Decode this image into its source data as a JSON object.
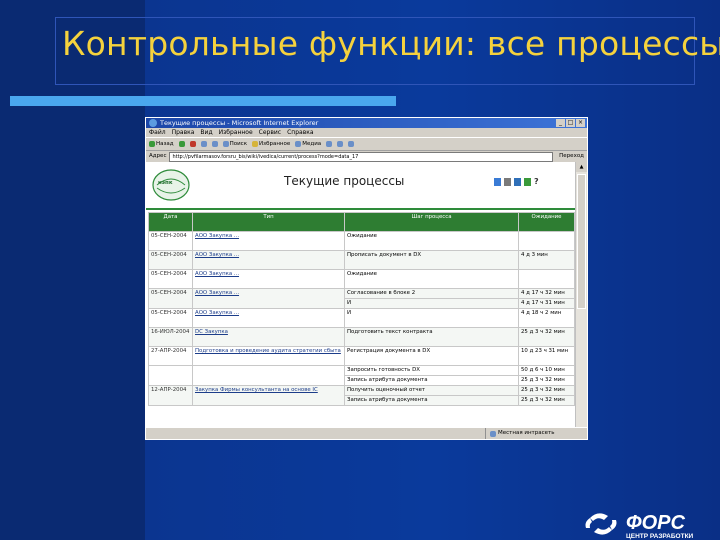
{
  "slide": {
    "title": "Контрольные функции: все процессы"
  },
  "colors": {
    "slide_bg": "#0a3a9c",
    "title_color": "#f5d23d",
    "underline": "#4aa7ee",
    "table_header": "#2e7d32"
  },
  "browser": {
    "title": "Текущие процессы - Microsoft Internet Explorer",
    "menu": [
      "Файл",
      "Правка",
      "Вид",
      "Избранное",
      "Сервис",
      "Справка"
    ],
    "toolbar": {
      "back_label": "Назад",
      "search_label": "Поиск",
      "favorites_label": "Избранное",
      "media_label": "Медиа"
    },
    "address_label": "Адрес",
    "address_value": "http://pvfilarmasov.forsru_bis/wiki/ivedica/current/process?mode=data_17",
    "go_label": "Переход",
    "status_left": "",
    "status_right": "Местная интрасеть"
  },
  "app": {
    "logo_text": "нэпк",
    "heading": "Текущие процессы",
    "help_label": "?",
    "icons": [
      "home-icon",
      "tools-icon",
      "people-icon",
      "document-icon"
    ]
  },
  "table": {
    "headers": [
      "Дата",
      "Тип",
      "Шаг процесса",
      "Ожидание"
    ],
    "rows": [
      {
        "date": "05-СЕН-2004",
        "type": "АОО Закупка ...",
        "step": "Ожидание",
        "wait": ""
      },
      {
        "date": "05-СЕН-2004",
        "type": "АОО Закупка ...",
        "step": "Прописать документ в DX",
        "wait": "4 д 3 мин"
      },
      {
        "date": "05-СЕН-2004",
        "type": "АОО Закупка ...",
        "step": "Ожидание",
        "wait": ""
      },
      {
        "date": "05-СЕН-2004",
        "type": "АОО Закупка ...",
        "step": "Согласование в блоке 2",
        "wait": "4 д 17 ч 32 мин"
      },
      {
        "date": "",
        "type": "",
        "step": "И",
        "wait": "4 д 17 ч 31 мин"
      },
      {
        "date": "05-СЕН-2004",
        "type": "АОО Закупка ...",
        "step": "И",
        "wait": "4 д 18 ч 2 мин"
      },
      {
        "date": "16-ИЮЛ-2004",
        "type": "DC Закупка",
        "step": "Подготовить текст контракта",
        "wait": "25 д 3 ч 32 мин"
      },
      {
        "date": "27-АПР-2004",
        "type": "Подготовка и проведение аудита стратегии сбыта",
        "step": "Регистрация документа в DX",
        "wait": "10 д 23 ч 31 мин"
      },
      {
        "date": "",
        "type": "",
        "step": "Запросить готовность DX",
        "wait": "50 д 6 ч 10 мин"
      },
      {
        "date": "",
        "type": "",
        "step": "Запись атрибута документа",
        "wait": "25 д 3 ч 32 мин"
      },
      {
        "date": "12-АПР-2004",
        "type": "Закупка Фирмы консультанта на основе IC",
        "step": "Получить оценочный отчет",
        "wait": "25 д 3 ч 32 мин"
      },
      {
        "date": "",
        "type": "",
        "step": "Запись атрибута документа",
        "wait": "25 д 3 ч 32 мин"
      }
    ]
  },
  "brand": {
    "name": "ФОРС",
    "subtitle": "ЦЕНТР РАЗРАБОТКИ"
  }
}
